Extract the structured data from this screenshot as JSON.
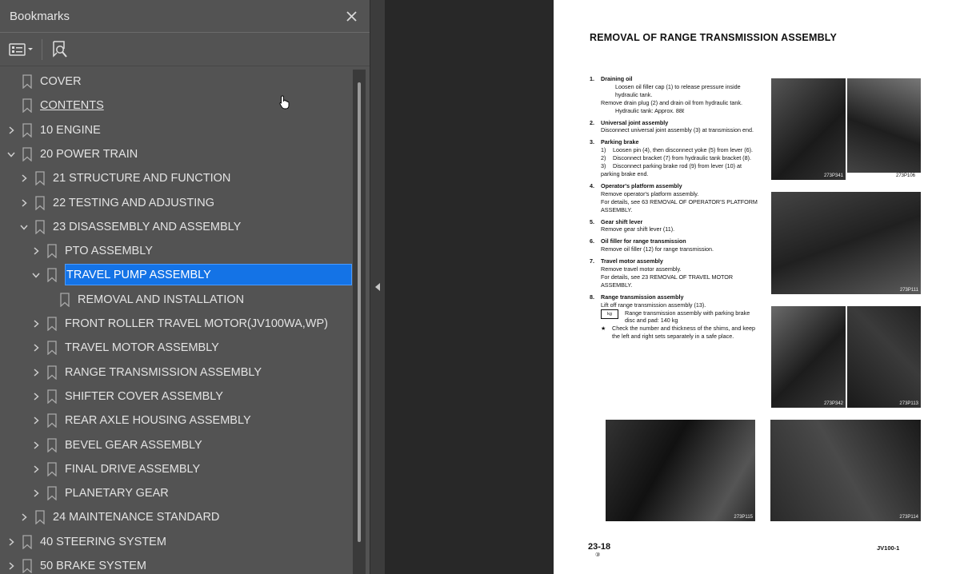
{
  "panel": {
    "title": "Bookmarks",
    "close_icon": "close-icon",
    "toolbar": {
      "options_icon": "bookmark-options-icon",
      "find_icon": "find-bookmark-icon"
    }
  },
  "bookmarks": [
    {
      "label": "COVER",
      "level": 0,
      "toggle": "none"
    },
    {
      "label": "CONTENTS",
      "level": 0,
      "toggle": "none",
      "underline": true
    },
    {
      "label": "10 ENGINE",
      "level": 0,
      "toggle": "collapsed"
    },
    {
      "label": "20 POWER TRAIN",
      "level": 0,
      "toggle": "expanded"
    },
    {
      "label": "21 STRUCTURE AND FUNCTION",
      "level": 1,
      "toggle": "collapsed"
    },
    {
      "label": "22 TESTING AND ADJUSTING",
      "level": 1,
      "toggle": "collapsed"
    },
    {
      "label": "23 DISASSEMBLY AND ASSEMBLY",
      "level": 1,
      "toggle": "expanded"
    },
    {
      "label": "PTO ASSEMBLY",
      "level": 2,
      "toggle": "collapsed"
    },
    {
      "label": "TRAVEL PUMP ASSEMBLY",
      "level": 2,
      "toggle": "expanded",
      "selected": true
    },
    {
      "label": "REMOVAL AND INSTALLATION",
      "level": 3,
      "toggle": "none"
    },
    {
      "label": "FRONT ROLLER TRAVEL MOTOR(JV100WA,WP)",
      "level": 2,
      "toggle": "collapsed"
    },
    {
      "label": "TRAVEL MOTOR ASSEMBLY",
      "level": 2,
      "toggle": "collapsed"
    },
    {
      "label": "RANGE TRANSMISSION ASSEMBLY",
      "level": 2,
      "toggle": "collapsed"
    },
    {
      "label": "SHIFTER COVER ASSEMBLY",
      "level": 2,
      "toggle": "collapsed"
    },
    {
      "label": "REAR AXLE HOUSING ASSEMBLY",
      "level": 2,
      "toggle": "collapsed"
    },
    {
      "label": "BEVEL GEAR ASSEMBLY",
      "level": 2,
      "toggle": "collapsed"
    },
    {
      "label": "FINAL DRIVE ASSEMBLY",
      "level": 2,
      "toggle": "collapsed"
    },
    {
      "label": "PLANETARY GEAR",
      "level": 2,
      "toggle": "collapsed"
    },
    {
      "label": "24 MAINTENANCE STANDARD",
      "level": 1,
      "toggle": "collapsed"
    },
    {
      "label": "40 STEERING SYSTEM",
      "level": 0,
      "toggle": "collapsed"
    },
    {
      "label": "50 BRAKE SYSTEM",
      "level": 0,
      "toggle": "collapsed"
    }
  ],
  "splitter": {
    "icon": "collapse-panel-arrow-icon"
  },
  "document": {
    "title": "REMOVAL OF RANGE TRANSMISSION ASSEMBLY",
    "steps": {
      "s1": {
        "num": "1.",
        "head": "Draining oil",
        "line1": "Loosen oil filler cap (1) to release pressure inside hydraulic tank.",
        "line2": "Remove drain plug (2) and drain oil from hydraulic tank.",
        "line3": "Hydraulic tank: Approx. 88ℓ"
      },
      "s2": {
        "num": "2.",
        "head": "Universal joint assembly",
        "line1": "Disconnect universal joint assembly (3) at transmission end."
      },
      "s3": {
        "num": "3.",
        "head": "Parking brake",
        "sub1n": "1)",
        "sub1": "Loosen pin (4), then disconnect yoke (5) from lever (6).",
        "sub2n": "2)",
        "sub2": "Disconnect bracket (7) from hydraulic tank bracket (8).",
        "sub3n": "3)",
        "sub3": "Disconnect parking brake rod (9) from lever (10) at parking brake end."
      },
      "s4": {
        "num": "4.",
        "head": "Operator's platform assembly",
        "line1": "Remove operator's platform assembly.",
        "line2": "For details, see 63 REMOVAL OF OPERATOR'S PLATFORM ASSEMBLY."
      },
      "s5": {
        "num": "5.",
        "head": "Gear shift lever",
        "line1": "Remove gear shift lever (11)."
      },
      "s6": {
        "num": "6.",
        "head": "Oil filler for range transmission",
        "line1": "Remove oil filler (12) for range transmission."
      },
      "s7": {
        "num": "7.",
        "head": "Travel motor assembly",
        "line1": "Remove travel motor assembly.",
        "line2": "For details, see 23 REMOVAL OF TRAVEL MOTOR ASSEMBLY."
      },
      "s8": {
        "num": "8.",
        "head": "Range transmission assembly",
        "line1": "Lift off range transmission assembly (13).",
        "line2": "Range transmission assembly with parking brake disc and pad: 140 kg",
        "star": "★",
        "line3": "Check the number and thickness of the shims, and keep the left and right sets separately in a safe place."
      }
    },
    "kg_label": "kg",
    "photos": {
      "p1": "273P341",
      "p2": "273P106",
      "p3": "273P111",
      "p4": "273P342",
      "p5": "273P113",
      "p6": "273P115",
      "p7": "273P114"
    },
    "page_number": "23-18",
    "page_sub": "③",
    "model": "JV100-1"
  }
}
